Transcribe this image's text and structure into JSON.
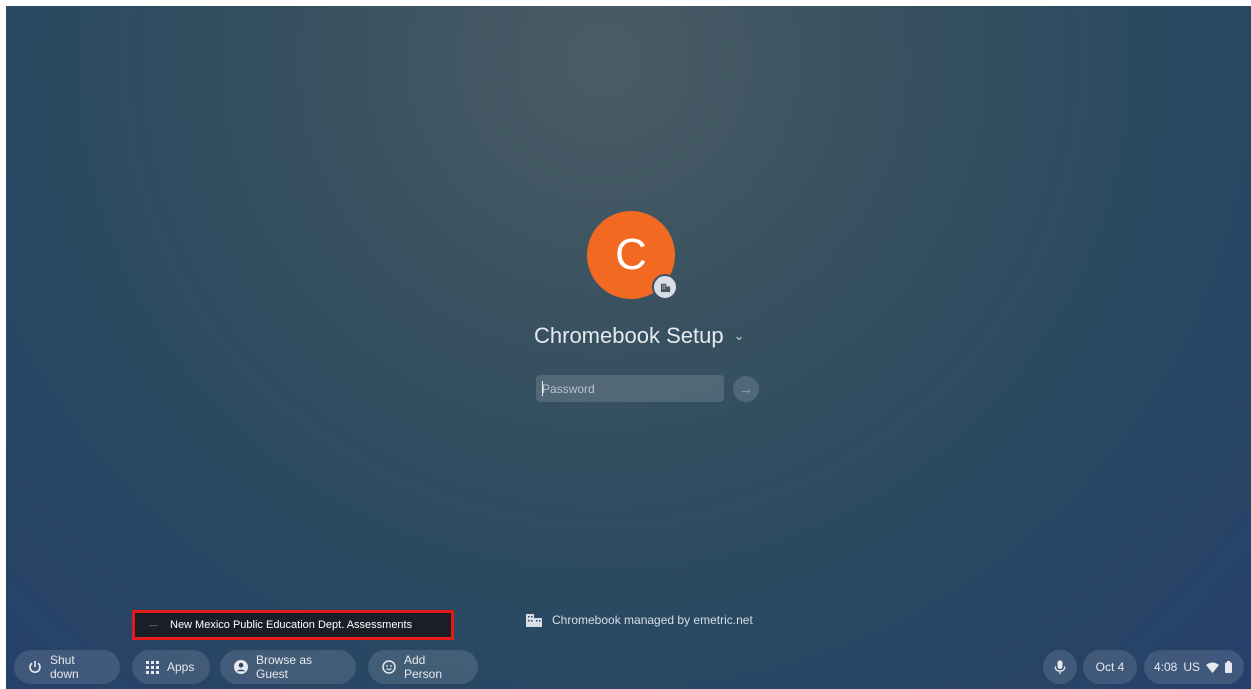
{
  "user": {
    "avatar_letter": "C",
    "name": "Chromebook Setup"
  },
  "password": {
    "placeholder": "Password"
  },
  "kiosk_app": {
    "label": "New Mexico Public Education Dept. Assessments"
  },
  "enterprise": {
    "text": "Chromebook managed by emetric.net"
  },
  "shelf": {
    "shutdown": "Shut down",
    "apps": "Apps",
    "guest": "Browse as Guest",
    "add_person": "Add Person"
  },
  "status": {
    "date": "Oct 4",
    "time": "4:08",
    "locale": "US"
  },
  "colors": {
    "avatar": "#f26a22",
    "kiosk_border": "#e31a1a"
  }
}
